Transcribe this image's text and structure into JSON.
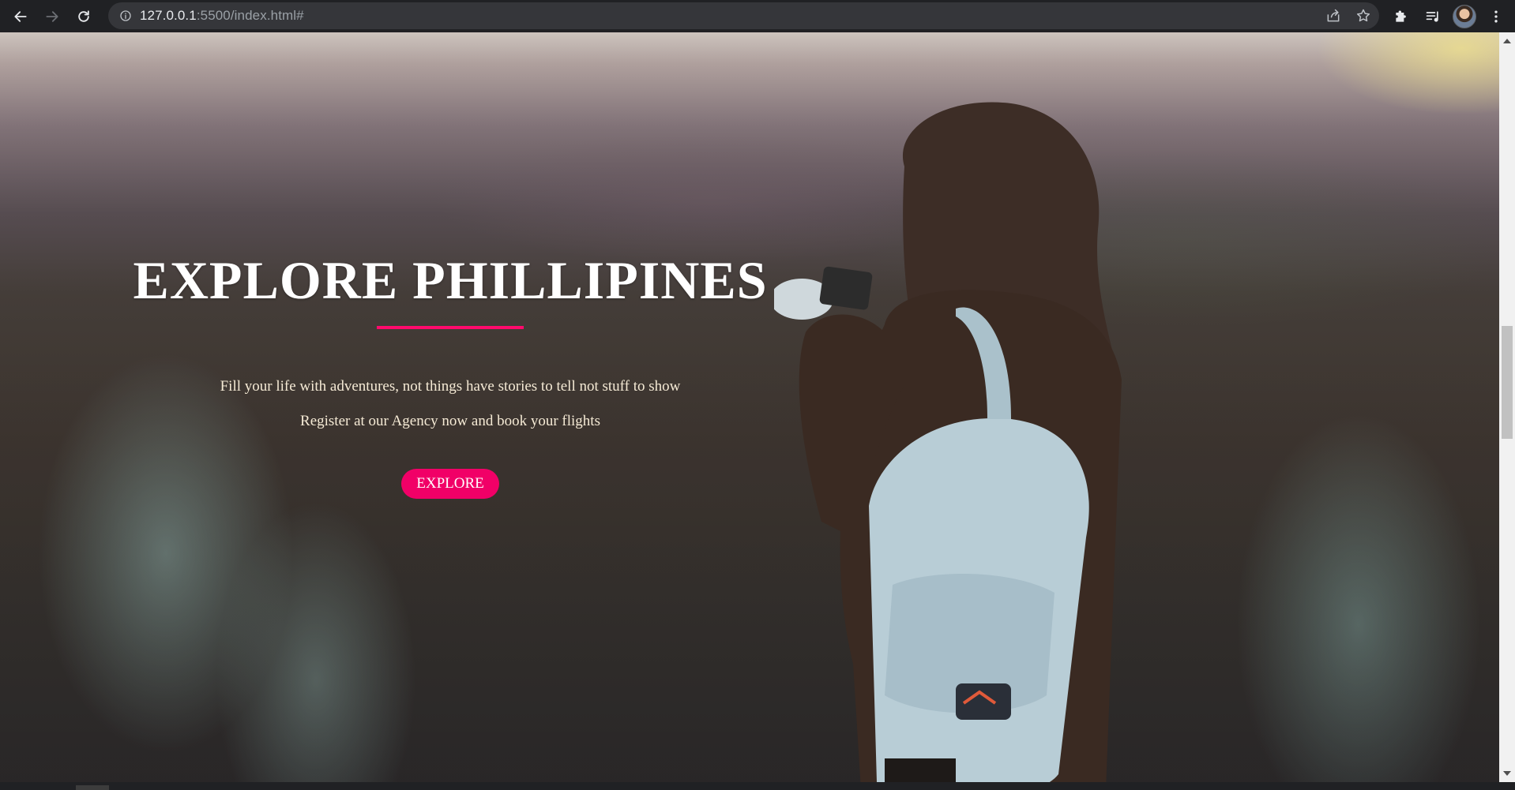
{
  "browser": {
    "url_host": "127.0.0.1",
    "url_rest": ":5500/index.html#",
    "icons": {
      "back": "back-arrow-icon",
      "forward": "forward-arrow-icon",
      "reload": "reload-icon",
      "site_info": "info-icon",
      "share": "share-icon",
      "bookmark": "star-icon",
      "extensions": "puzzle-icon",
      "reading_list": "reading-list-icon",
      "profile": "avatar",
      "menu": "kebab-menu-icon"
    }
  },
  "hero": {
    "title": "EXPLORE PHILLIPINES",
    "tagline_1": "Fill your life with adventures, not things have stories to tell not stuff to show",
    "tagline_2": "Register at our Agency now and book your flights",
    "button_label": "EXPLORE",
    "accent_color": "#f10067"
  }
}
